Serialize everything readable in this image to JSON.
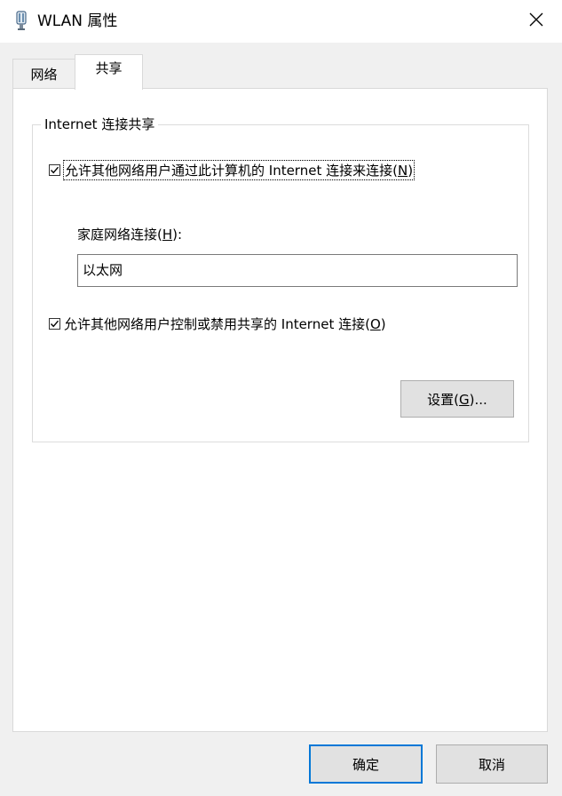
{
  "window": {
    "title": "WLAN 属性",
    "icon": "network-adapter-icon",
    "close_glyph": "✕"
  },
  "tabs": [
    {
      "label": "网络",
      "selected": false
    },
    {
      "label": "共享",
      "selected": true
    }
  ],
  "sharing": {
    "group_title": "Internet 连接共享",
    "allow_share": {
      "checked": true,
      "text_before": "允许其他网络用户通过此计算机的 Internet 连接来连接(",
      "mnemonic": "N",
      "text_after": ")"
    },
    "home_network": {
      "text_before": "家庭网络连接(",
      "mnemonic": "H",
      "text_after": "):",
      "value": "以太网"
    },
    "allow_control": {
      "checked": true,
      "text_before": "允许其他网络用户控制或禁用共享的 Internet 连接(",
      "mnemonic": "O",
      "text_after": ")"
    },
    "settings_button": {
      "text_before": "设置(",
      "mnemonic": "G",
      "text_after": ")..."
    }
  },
  "footer": {
    "ok_label": "确定",
    "cancel_label": "取消"
  }
}
